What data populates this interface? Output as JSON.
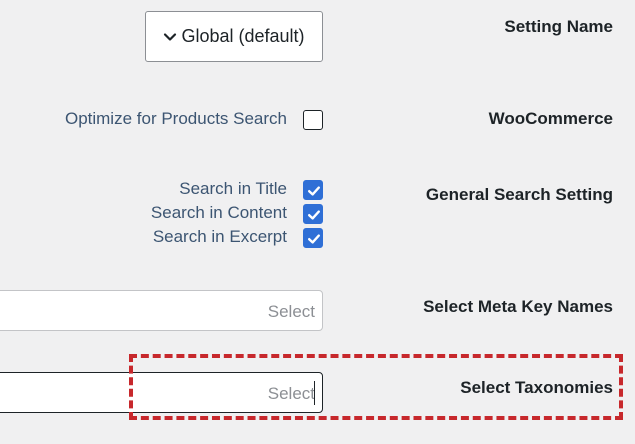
{
  "rows": {
    "setting_name": {
      "label": "Setting Name",
      "dropdown_value": "Global (default)",
      "dropdown_icon": "chevron-down-icon"
    },
    "woocommerce": {
      "label": "WooCommerce",
      "option_label": "Optimize for Products Search",
      "checked": false
    },
    "general_search": {
      "label": "General Search Setting",
      "options": [
        {
          "label": "Search in Title",
          "checked": true
        },
        {
          "label": "Search in Content",
          "checked": true
        },
        {
          "label": "Search in Excerpt",
          "checked": true
        }
      ]
    },
    "meta_keys": {
      "label": "Select Meta Key Names",
      "placeholder": "Select"
    },
    "taxonomies": {
      "label": "Select Taxonomies",
      "placeholder": "Select"
    }
  },
  "colors": {
    "checkbox_checked": "#2f6fd6",
    "highlight_border": "#c7282c",
    "background": "#f0f0f1"
  }
}
